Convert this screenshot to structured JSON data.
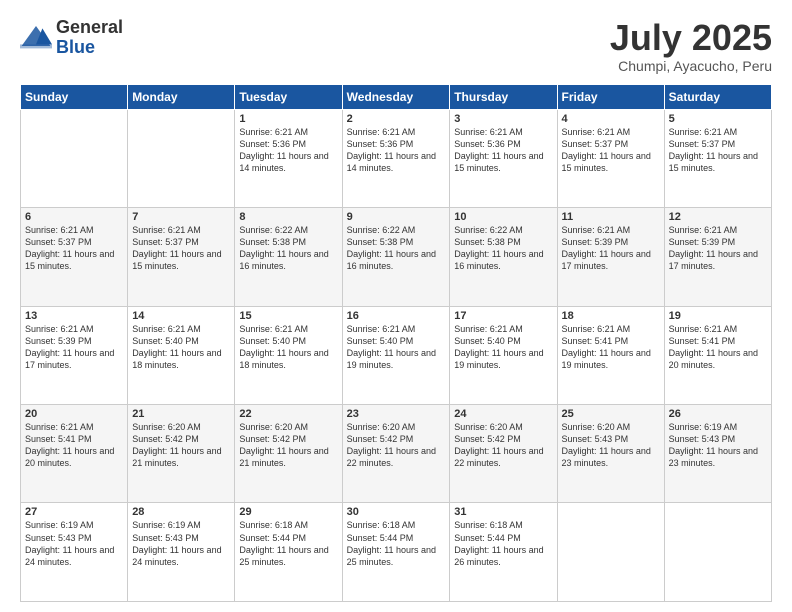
{
  "logo": {
    "general": "General",
    "blue": "Blue"
  },
  "title": "July 2025",
  "subtitle": "Chumpi, Ayacucho, Peru",
  "headers": [
    "Sunday",
    "Monday",
    "Tuesday",
    "Wednesday",
    "Thursday",
    "Friday",
    "Saturday"
  ],
  "weeks": [
    [
      {
        "day": "",
        "sunrise": "",
        "sunset": "",
        "daylight": ""
      },
      {
        "day": "",
        "sunrise": "",
        "sunset": "",
        "daylight": ""
      },
      {
        "day": "1",
        "sunrise": "Sunrise: 6:21 AM",
        "sunset": "Sunset: 5:36 PM",
        "daylight": "Daylight: 11 hours and 14 minutes."
      },
      {
        "day": "2",
        "sunrise": "Sunrise: 6:21 AM",
        "sunset": "Sunset: 5:36 PM",
        "daylight": "Daylight: 11 hours and 14 minutes."
      },
      {
        "day": "3",
        "sunrise": "Sunrise: 6:21 AM",
        "sunset": "Sunset: 5:36 PM",
        "daylight": "Daylight: 11 hours and 15 minutes."
      },
      {
        "day": "4",
        "sunrise": "Sunrise: 6:21 AM",
        "sunset": "Sunset: 5:37 PM",
        "daylight": "Daylight: 11 hours and 15 minutes."
      },
      {
        "day": "5",
        "sunrise": "Sunrise: 6:21 AM",
        "sunset": "Sunset: 5:37 PM",
        "daylight": "Daylight: 11 hours and 15 minutes."
      }
    ],
    [
      {
        "day": "6",
        "sunrise": "Sunrise: 6:21 AM",
        "sunset": "Sunset: 5:37 PM",
        "daylight": "Daylight: 11 hours and 15 minutes."
      },
      {
        "day": "7",
        "sunrise": "Sunrise: 6:21 AM",
        "sunset": "Sunset: 5:37 PM",
        "daylight": "Daylight: 11 hours and 15 minutes."
      },
      {
        "day": "8",
        "sunrise": "Sunrise: 6:22 AM",
        "sunset": "Sunset: 5:38 PM",
        "daylight": "Daylight: 11 hours and 16 minutes."
      },
      {
        "day": "9",
        "sunrise": "Sunrise: 6:22 AM",
        "sunset": "Sunset: 5:38 PM",
        "daylight": "Daylight: 11 hours and 16 minutes."
      },
      {
        "day": "10",
        "sunrise": "Sunrise: 6:22 AM",
        "sunset": "Sunset: 5:38 PM",
        "daylight": "Daylight: 11 hours and 16 minutes."
      },
      {
        "day": "11",
        "sunrise": "Sunrise: 6:21 AM",
        "sunset": "Sunset: 5:39 PM",
        "daylight": "Daylight: 11 hours and 17 minutes."
      },
      {
        "day": "12",
        "sunrise": "Sunrise: 6:21 AM",
        "sunset": "Sunset: 5:39 PM",
        "daylight": "Daylight: 11 hours and 17 minutes."
      }
    ],
    [
      {
        "day": "13",
        "sunrise": "Sunrise: 6:21 AM",
        "sunset": "Sunset: 5:39 PM",
        "daylight": "Daylight: 11 hours and 17 minutes."
      },
      {
        "day": "14",
        "sunrise": "Sunrise: 6:21 AM",
        "sunset": "Sunset: 5:40 PM",
        "daylight": "Daylight: 11 hours and 18 minutes."
      },
      {
        "day": "15",
        "sunrise": "Sunrise: 6:21 AM",
        "sunset": "Sunset: 5:40 PM",
        "daylight": "Daylight: 11 hours and 18 minutes."
      },
      {
        "day": "16",
        "sunrise": "Sunrise: 6:21 AM",
        "sunset": "Sunset: 5:40 PM",
        "daylight": "Daylight: 11 hours and 19 minutes."
      },
      {
        "day": "17",
        "sunrise": "Sunrise: 6:21 AM",
        "sunset": "Sunset: 5:40 PM",
        "daylight": "Daylight: 11 hours and 19 minutes."
      },
      {
        "day": "18",
        "sunrise": "Sunrise: 6:21 AM",
        "sunset": "Sunset: 5:41 PM",
        "daylight": "Daylight: 11 hours and 19 minutes."
      },
      {
        "day": "19",
        "sunrise": "Sunrise: 6:21 AM",
        "sunset": "Sunset: 5:41 PM",
        "daylight": "Daylight: 11 hours and 20 minutes."
      }
    ],
    [
      {
        "day": "20",
        "sunrise": "Sunrise: 6:21 AM",
        "sunset": "Sunset: 5:41 PM",
        "daylight": "Daylight: 11 hours and 20 minutes."
      },
      {
        "day": "21",
        "sunrise": "Sunrise: 6:20 AM",
        "sunset": "Sunset: 5:42 PM",
        "daylight": "Daylight: 11 hours and 21 minutes."
      },
      {
        "day": "22",
        "sunrise": "Sunrise: 6:20 AM",
        "sunset": "Sunset: 5:42 PM",
        "daylight": "Daylight: 11 hours and 21 minutes."
      },
      {
        "day": "23",
        "sunrise": "Sunrise: 6:20 AM",
        "sunset": "Sunset: 5:42 PM",
        "daylight": "Daylight: 11 hours and 22 minutes."
      },
      {
        "day": "24",
        "sunrise": "Sunrise: 6:20 AM",
        "sunset": "Sunset: 5:42 PM",
        "daylight": "Daylight: 11 hours and 22 minutes."
      },
      {
        "day": "25",
        "sunrise": "Sunrise: 6:20 AM",
        "sunset": "Sunset: 5:43 PM",
        "daylight": "Daylight: 11 hours and 23 minutes."
      },
      {
        "day": "26",
        "sunrise": "Sunrise: 6:19 AM",
        "sunset": "Sunset: 5:43 PM",
        "daylight": "Daylight: 11 hours and 23 minutes."
      }
    ],
    [
      {
        "day": "27",
        "sunrise": "Sunrise: 6:19 AM",
        "sunset": "Sunset: 5:43 PM",
        "daylight": "Daylight: 11 hours and 24 minutes."
      },
      {
        "day": "28",
        "sunrise": "Sunrise: 6:19 AM",
        "sunset": "Sunset: 5:43 PM",
        "daylight": "Daylight: 11 hours and 24 minutes."
      },
      {
        "day": "29",
        "sunrise": "Sunrise: 6:18 AM",
        "sunset": "Sunset: 5:44 PM",
        "daylight": "Daylight: 11 hours and 25 minutes."
      },
      {
        "day": "30",
        "sunrise": "Sunrise: 6:18 AM",
        "sunset": "Sunset: 5:44 PM",
        "daylight": "Daylight: 11 hours and 25 minutes."
      },
      {
        "day": "31",
        "sunrise": "Sunrise: 6:18 AM",
        "sunset": "Sunset: 5:44 PM",
        "daylight": "Daylight: 11 hours and 26 minutes."
      },
      {
        "day": "",
        "sunrise": "",
        "sunset": "",
        "daylight": ""
      },
      {
        "day": "",
        "sunrise": "",
        "sunset": "",
        "daylight": ""
      }
    ]
  ]
}
